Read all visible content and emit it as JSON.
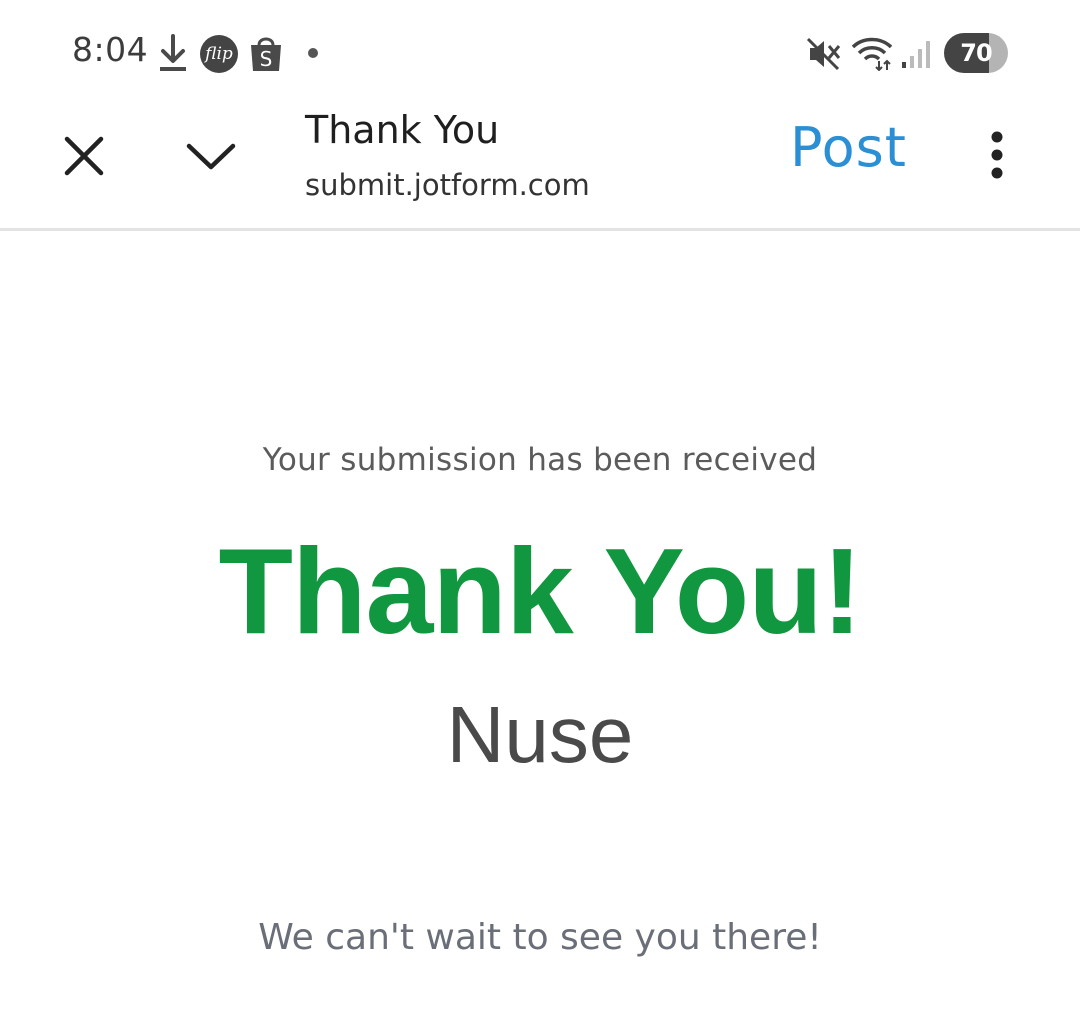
{
  "status_bar": {
    "time": "8:04",
    "icons": [
      "download-icon",
      "flip-app-icon",
      "shopee-icon",
      "notification-dot",
      "mute-icon",
      "wifi-icon",
      "signal-icon"
    ],
    "flip_label": "flip",
    "shop_label": "S",
    "battery_level": "70"
  },
  "toolbar": {
    "title": "Thank You",
    "url": "submit.jotform.com",
    "post_label": "Post",
    "post_color": "#2b8fd6",
    "icons": [
      "close-icon",
      "chevron-down-icon",
      "more-vert-icon"
    ]
  },
  "page": {
    "received_text": "Your submission has been received",
    "heading": "Thank You!",
    "heading_color": "#11973f",
    "name": "Nuse",
    "closing_text": "We can't wait to see you there!"
  }
}
